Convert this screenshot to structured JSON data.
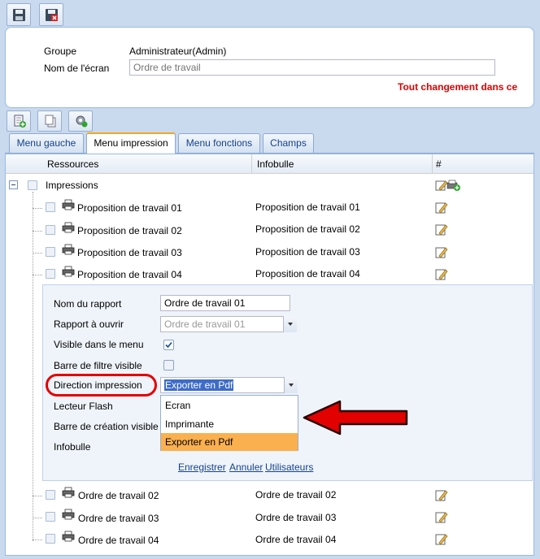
{
  "header": {
    "group_label": "Groupe",
    "group_value": "Administrateur(Admin)",
    "screen_label": "Nom de l'écran",
    "screen_placeholder": "Ordre de travail",
    "warning": "Tout changement dans ce"
  },
  "tabs": [
    {
      "label": "Menu gauche",
      "active": false
    },
    {
      "label": "Menu impression",
      "active": true
    },
    {
      "label": "Menu fonctions",
      "active": false
    },
    {
      "label": "Champs",
      "active": false
    }
  ],
  "grid": {
    "columns": [
      "Ressources",
      "Infobulle",
      "#"
    ],
    "root": "Impressions",
    "rows": [
      {
        "resource": "Proposition de travail 01",
        "tooltip": "Proposition de travail 01"
      },
      {
        "resource": "Proposition de travail 02",
        "tooltip": "Proposition de travail 02"
      },
      {
        "resource": "Proposition de travail 03",
        "tooltip": "Proposition de travail 03"
      },
      {
        "resource": "Proposition de travail 04",
        "tooltip": "Proposition de travail 04"
      }
    ],
    "rows_after": [
      {
        "resource": "Ordre de travail 02",
        "tooltip": "Ordre de travail 02"
      },
      {
        "resource": "Ordre de travail 03",
        "tooltip": "Ordre de travail 03"
      },
      {
        "resource": "Ordre de travail 04",
        "tooltip": "Ordre de travail 04"
      }
    ]
  },
  "form": {
    "report_name_label": "Nom du rapport",
    "report_name_value": "Ordre de travail 01",
    "report_open_label": "Rapport à ouvrir",
    "report_open_value": "Ordre de travail 01",
    "visible_label": "Visible dans le menu",
    "visible_checked": true,
    "filter_bar_label": "Barre de filtre visible",
    "filter_bar_checked": false,
    "direction_label": "Direction impression",
    "direction_value": "Exporter en Pdf",
    "flash_label": "Lecteur Flash",
    "creation_bar_label": "Barre de création visible",
    "tooltip_label": "Infobulle",
    "dropdown_options": [
      "Ecran",
      "Imprimante",
      "Exporter en Pdf"
    ],
    "dropdown_selected": "Exporter en Pdf",
    "save_link": "Enregistrer",
    "cancel_link": "Annuler",
    "users_link": "Utilisateurs"
  },
  "icons": {
    "save": "save-icon",
    "save_close": "save-close-icon",
    "add": "add-icon",
    "copy": "copy-icon",
    "settings": "gear-icon",
    "print": "printer-icon",
    "edit": "edit-icon"
  },
  "colors": {
    "warning": "#e00000",
    "highlight": "#fbb04f",
    "annotation": "#e30000"
  }
}
